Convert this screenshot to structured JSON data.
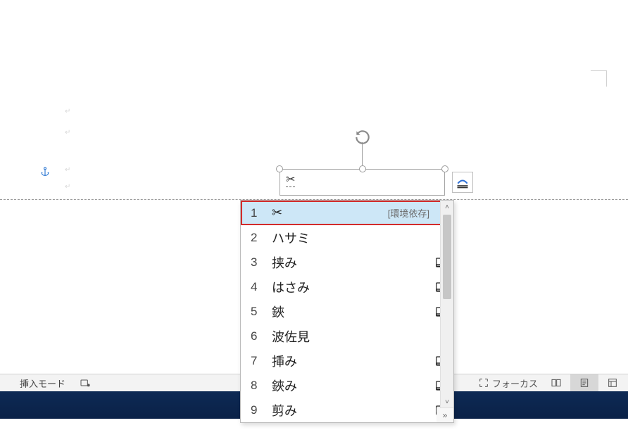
{
  "document": {
    "textbox_text": "✂",
    "para_marks": [
      "↵",
      "↵",
      "↵",
      "↵"
    ]
  },
  "ime": {
    "candidates": [
      {
        "n": "1",
        "text": "✂",
        "tag": "[環境依存]",
        "selected": true,
        "dict": false,
        "highlighted": true
      },
      {
        "n": "2",
        "text": "ハサミ",
        "tag": "",
        "selected": false,
        "dict": false
      },
      {
        "n": "3",
        "text": "挟み",
        "tag": "",
        "selected": false,
        "dict": true
      },
      {
        "n": "4",
        "text": "はさみ",
        "tag": "",
        "selected": false,
        "dict": true
      },
      {
        "n": "5",
        "text": "鋏",
        "tag": "",
        "selected": false,
        "dict": true
      },
      {
        "n": "6",
        "text": "波佐見",
        "tag": "",
        "selected": false,
        "dict": false
      },
      {
        "n": "7",
        "text": "挿み",
        "tag": "",
        "selected": false,
        "dict": true
      },
      {
        "n": "8",
        "text": "鋏み",
        "tag": "",
        "selected": false,
        "dict": true
      },
      {
        "n": "9",
        "text": "剪み",
        "tag": "",
        "selected": false,
        "dict": true
      }
    ],
    "expand_glyph": "»",
    "scroll_up": "˄",
    "scroll_down": "˅"
  },
  "statusbar": {
    "mode_label": "挿入モード",
    "focus_label": "フォーカス"
  },
  "icons": {
    "scissors": "✂"
  }
}
